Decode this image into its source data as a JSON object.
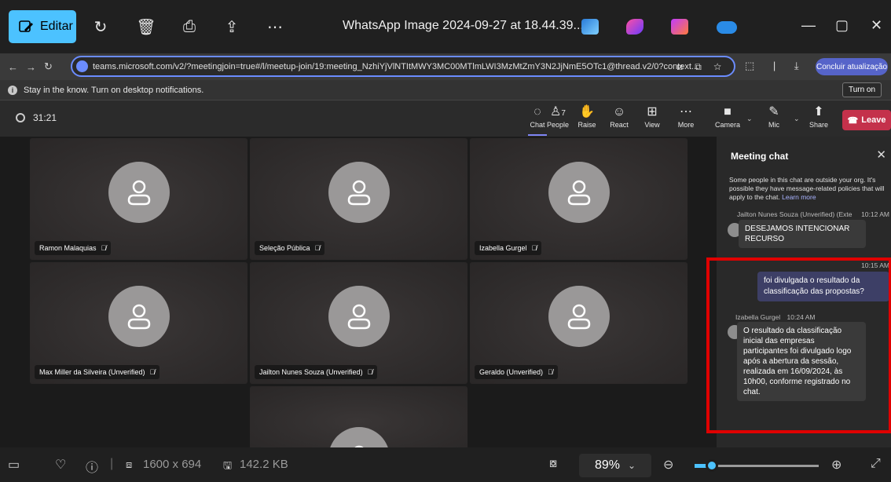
{
  "photos_app": {
    "edit_label": "Editar",
    "title": "WhatsApp Image 2024-09-27 at 18.44.39...",
    "colors": {
      "accent": "#4cc2ff"
    }
  },
  "browser": {
    "url": "teams.microsoft.com/v2/?meetingjoin=true#/l/meetup-join/19:meeting_NzhiYjVlNTItMWY3MC00MTlmLWI3MzMtZmY3N2JjNmE5OTc1@thread.v2/0?context...",
    "update_label": "Concluir atualização"
  },
  "notification": {
    "text": "Stay in the know. Turn on desktop notifications.",
    "button": "Turn on"
  },
  "meeting": {
    "timer": "31:21",
    "toolbar": {
      "chat": "Chat",
      "people": "People",
      "people_count": "7",
      "raise": "Raise",
      "react": "React",
      "view": "View",
      "more": "More",
      "camera": "Camera",
      "mic": "Mic",
      "share": "Share",
      "leave": "Leave"
    },
    "participants": [
      {
        "name": "Ramon Malaquias"
      },
      {
        "name": "Seleção Pública"
      },
      {
        "name": "Izabella Gurgel"
      },
      {
        "name": "Max Miller da Silveira (Unverified)"
      },
      {
        "name": "Jailton Nunes Souza (Unverified)"
      },
      {
        "name": "Geraldo (Unverified)"
      }
    ]
  },
  "chat": {
    "title": "Meeting chat",
    "note": "Some people in this chat are outside your org. It's possible they have message-related policies that will apply to the chat.",
    "learn_more": "Learn more",
    "messages": [
      {
        "sender": "Jailton Nunes Souza (Unverified) (Exte",
        "time": "10:12 AM",
        "text": "DESEJAMOS INTENCIONAR RECURSO"
      },
      {
        "sender": "",
        "time": "10:15 AM",
        "text": "foi divulgada o resultado da classificação das propostas?"
      },
      {
        "sender": "Izabella Gurgel",
        "time": "10:24 AM",
        "text": "O resultado da classificação inicial das empresas participantes foi divulgado logo após a abertura da sessão, realizada em 16/09/2024, às 10h00, conforme registrado no chat."
      }
    ]
  },
  "bottom_bar": {
    "dimensions": "1600 x 694",
    "size": "142.2 KB",
    "zoom": "89%",
    "zoom_fraction": 0.14
  }
}
